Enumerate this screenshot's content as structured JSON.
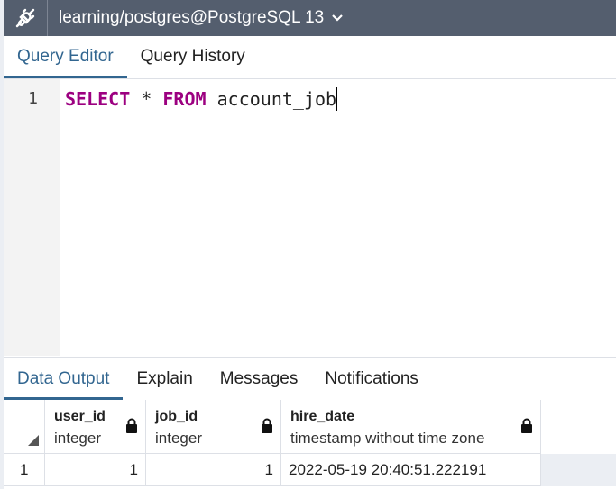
{
  "connection": {
    "label": "learning/postgres@PostgreSQL 13",
    "icon": "plug-connection-icon",
    "caret_icon": "chevron-down-icon"
  },
  "editor_tabs": [
    "Query Editor",
    "Query History"
  ],
  "editor": {
    "line_number": "1",
    "keyword_select": "SELECT",
    "star": "*",
    "keyword_from": "FROM",
    "table": "account_job"
  },
  "output_tabs": [
    "Data Output",
    "Explain",
    "Messages",
    "Notifications"
  ],
  "grid": {
    "columns": [
      {
        "name": "user_id",
        "type": "integer"
      },
      {
        "name": "job_id",
        "type": "integer"
      },
      {
        "name": "hire_date",
        "type": "timestamp without time zone"
      }
    ],
    "rows": [
      {
        "row_number": "1",
        "cells": [
          "1",
          "1",
          "2022-05-19 20:40:51.222191"
        ]
      }
    ]
  },
  "colors": {
    "header_bar": "#545e6e",
    "accent": "#326690",
    "keyword": "#9c0080"
  }
}
